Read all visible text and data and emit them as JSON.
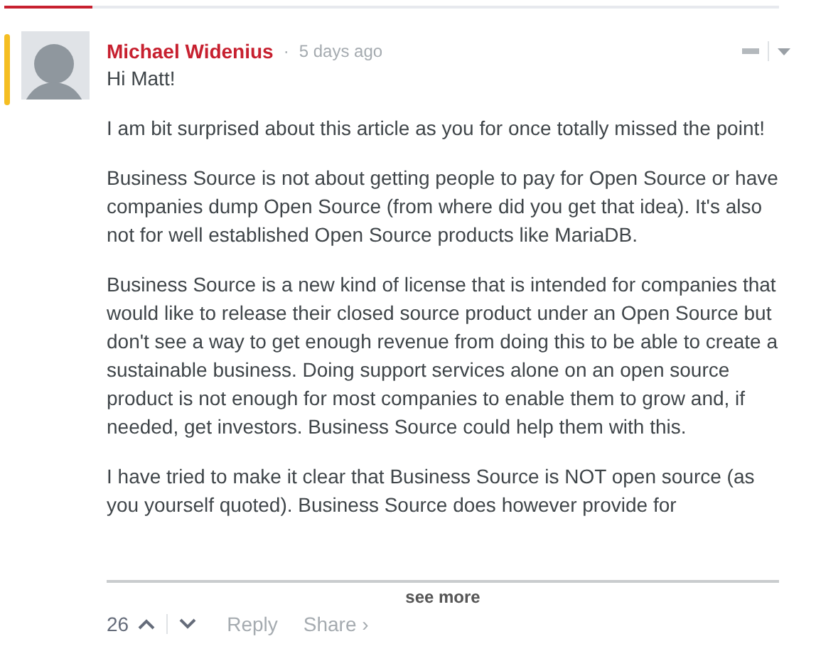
{
  "comment": {
    "author": "Michael Widenius",
    "separator": "·",
    "time": "5 days ago",
    "highlighted": true,
    "paragraphs": [
      "Hi Matt!",
      "I am bit surprised about this article as you for once totally missed the point!",
      "Business Source is not about getting people to pay for Open Source or have companies dump Open Source (from where did you get that idea). It's also not for well established Open Source products like MariaDB.",
      "Business Source is a new kind of license that is intended for companies that would like to release their closed source product under an Open Source but don't see a way to get enough revenue from doing this to be able to create a sustainable business. Doing support services alone on an open source product is not enough for most companies to enable them to grow and, if needed, get investors. Business Source could help them with this.",
      "I have tried to make it clear that Business Source is NOT open source (as you yourself quoted). Business Source does however provide for"
    ],
    "see_more": "see more",
    "votes": "26",
    "reply": "Reply",
    "share": "Share ›"
  }
}
